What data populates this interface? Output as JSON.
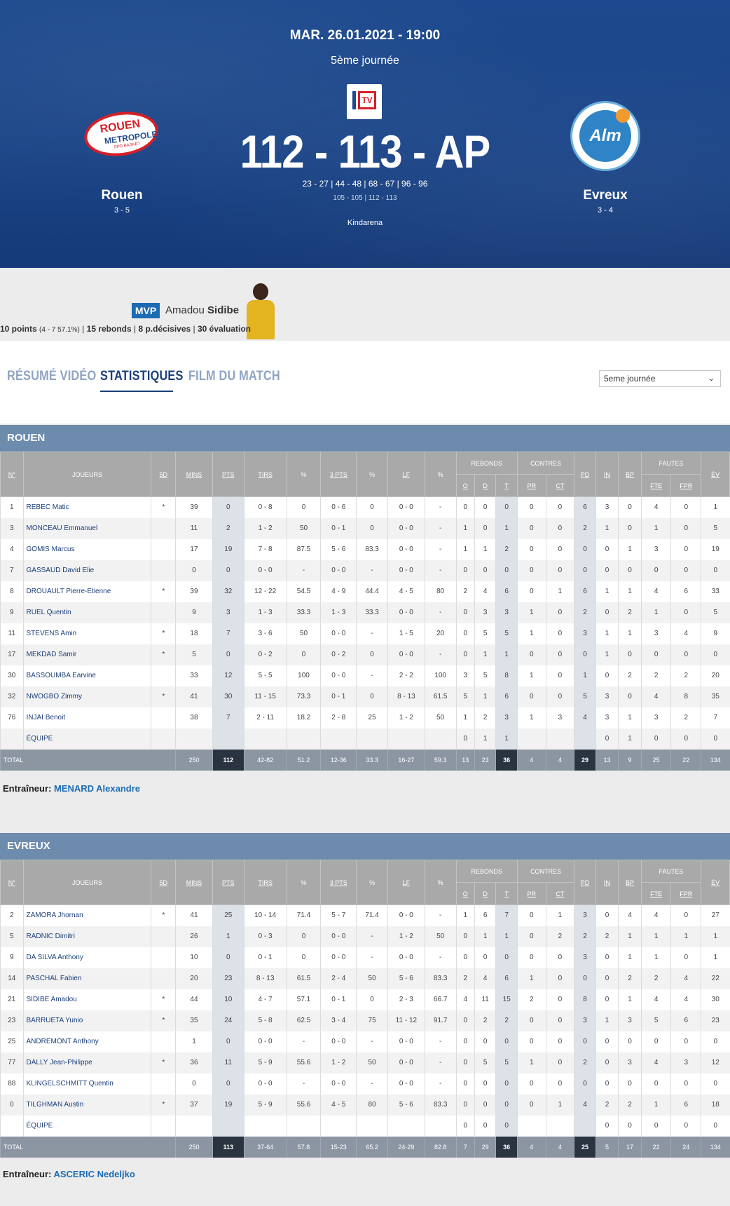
{
  "match": {
    "date": "MAR. 26.01.2021 - 19:00",
    "round": "5ème journée",
    "tv_label": "TV",
    "score": "112 - 113 - AP",
    "quarters": "23 - 27 | 44 - 48 | 68 - 67 | 96 - 96",
    "overtime": "105 - 105 | 112 - 113",
    "venue": "Kindarena",
    "home": {
      "name": "Rouen",
      "record": "3 - 5",
      "logo_line1": "ROUEN",
      "logo_line2": "METROPOLE",
      "logo_line3": "SPO BASKET"
    },
    "away": {
      "name": "Evreux",
      "record": "3 - 4",
      "logo_text": "Alm"
    }
  },
  "mvp": {
    "badge": "MVP",
    "first_name": "Amadou",
    "last_name": "Sidibe",
    "points": "10 points",
    "shooting": "(4 - 7 57.1%)",
    "rebounds": "15 rebonds",
    "assists": "8 p.décisives",
    "evaluation": "30 évaluation"
  },
  "tabs": [
    "RÉSUMÉ VIDÉO",
    "STATISTIQUES",
    "FILM DU MATCH"
  ],
  "round_select": {
    "value": "5eme journée"
  },
  "headers": {
    "num": "N°",
    "player": "JOUEURS",
    "five": "5D",
    "mins": "MINS",
    "pts": "PTS",
    "tirs": "TIRS",
    "pct": "%",
    "three": "3 PTS",
    "lf": "LF",
    "rebonds": "REBONDS",
    "o": "O",
    "d": "D",
    "t": "T",
    "contres": "CONTRES",
    "pr": "PR",
    "ct": "CT",
    "pd": "PD",
    "in": "IN",
    "bp": "BP",
    "fautes": "FAUTES",
    "fte": "FTE",
    "fpr": "FPR",
    "ev": "ÉV"
  },
  "teams": [
    {
      "name": "ROUEN",
      "coach_label": "Entraîneur:",
      "coach": "MENARD Alexandre",
      "rows": [
        [
          "1",
          "REBEC Matic",
          "*",
          "39",
          "0",
          "0 - 8",
          "0",
          "0 - 6",
          "0",
          "0 - 0",
          "-",
          "0",
          "0",
          "0",
          "0",
          "0",
          "6",
          "3",
          "0",
          "4",
          "0",
          "1"
        ],
        [
          "3",
          "MONCEAU Emmanuel",
          "",
          "11",
          "2",
          "1 - 2",
          "50",
          "0 - 1",
          "0",
          "0 - 0",
          "-",
          "1",
          "0",
          "1",
          "0",
          "0",
          "2",
          "1",
          "0",
          "1",
          "0",
          "5"
        ],
        [
          "4",
          "GOMIS Marcus",
          "",
          "17",
          "19",
          "7 - 8",
          "87.5",
          "5 - 6",
          "83.3",
          "0 - 0",
          "-",
          "1",
          "1",
          "2",
          "0",
          "0",
          "0",
          "0",
          "1",
          "3",
          "0",
          "19"
        ],
        [
          "7",
          "GASSAUD David Elie",
          "",
          "0",
          "0",
          "0 - 0",
          "-",
          "0 - 0",
          "-",
          "0 - 0",
          "-",
          "0",
          "0",
          "0",
          "0",
          "0",
          "0",
          "0",
          "0",
          "0",
          "0",
          "0"
        ],
        [
          "8",
          "DROUAULT Pierre-Etienne",
          "*",
          "39",
          "32",
          "12 - 22",
          "54.5",
          "4 - 9",
          "44.4",
          "4 - 5",
          "80",
          "2",
          "4",
          "6",
          "0",
          "1",
          "6",
          "1",
          "1",
          "4",
          "6",
          "33"
        ],
        [
          "9",
          "RUEL Quentin",
          "",
          "9",
          "3",
          "1 - 3",
          "33.3",
          "1 - 3",
          "33.3",
          "0 - 0",
          "-",
          "0",
          "3",
          "3",
          "1",
          "0",
          "2",
          "0",
          "2",
          "1",
          "0",
          "5"
        ],
        [
          "11",
          "STEVENS Amin",
          "*",
          "18",
          "7",
          "3 - 6",
          "50",
          "0 - 0",
          "-",
          "1 - 5",
          "20",
          "0",
          "5",
          "5",
          "1",
          "0",
          "3",
          "1",
          "1",
          "3",
          "4",
          "9"
        ],
        [
          "17",
          "MEKDAD Samir",
          "*",
          "5",
          "0",
          "0 - 2",
          "0",
          "0 - 2",
          "0",
          "0 - 0",
          "-",
          "0",
          "1",
          "1",
          "0",
          "0",
          "0",
          "1",
          "0",
          "0",
          "0",
          "0"
        ],
        [
          "30",
          "BASSOUMBA Earvine",
          "",
          "33",
          "12",
          "5 - 5",
          "100",
          "0 - 0",
          "-",
          "2 - 2",
          "100",
          "3",
          "5",
          "8",
          "1",
          "0",
          "1",
          "0",
          "2",
          "2",
          "2",
          "20"
        ],
        [
          "32",
          "NWOGBO Zimmy",
          "*",
          "41",
          "30",
          "11 - 15",
          "73.3",
          "0 - 1",
          "0",
          "8 - 13",
          "61.5",
          "5",
          "1",
          "6",
          "0",
          "0",
          "5",
          "3",
          "0",
          "4",
          "8",
          "35"
        ],
        [
          "76",
          "INJAI Benoit",
          "",
          "38",
          "7",
          "2 - 11",
          "18.2",
          "2 - 8",
          "25",
          "1 - 2",
          "50",
          "1",
          "2",
          "3",
          "1",
          "3",
          "4",
          "3",
          "1",
          "3",
          "2",
          "7"
        ],
        [
          "",
          "ÉQUIPE",
          "",
          "",
          "",
          "",
          "",
          "",
          "",
          "",
          "",
          "0",
          "1",
          "1",
          "",
          "",
          "",
          "0",
          "1",
          "0",
          "0",
          "0"
        ]
      ],
      "total": [
        "TOTAL",
        "250",
        "112",
        "42-82",
        "51.2",
        "12-36",
        "33.3",
        "16-27",
        "59.3",
        "13",
        "23",
        "36",
        "4",
        "4",
        "29",
        "13",
        "9",
        "25",
        "22",
        "134"
      ]
    },
    {
      "name": "EVREUX",
      "coach_label": "Entraîneur:",
      "coach": "ASCERIC Nedeljko",
      "rows": [
        [
          "2",
          "ZAMORA Jhornan",
          "*",
          "41",
          "25",
          "10 - 14",
          "71.4",
          "5 - 7",
          "71.4",
          "0 - 0",
          "-",
          "1",
          "6",
          "7",
          "0",
          "1",
          "3",
          "0",
          "4",
          "4",
          "0",
          "27"
        ],
        [
          "5",
          "RADNIC Dimitri",
          "",
          "26",
          "1",
          "0 - 3",
          "0",
          "0 - 0",
          "-",
          "1 - 2",
          "50",
          "0",
          "1",
          "1",
          "0",
          "2",
          "2",
          "2",
          "1",
          "1",
          "1",
          "1"
        ],
        [
          "9",
          "DA SILVA Anthony",
          "",
          "10",
          "0",
          "0 - 1",
          "0",
          "0 - 0",
          "-",
          "0 - 0",
          "-",
          "0",
          "0",
          "0",
          "0",
          "0",
          "3",
          "0",
          "1",
          "1",
          "0",
          "1"
        ],
        [
          "14",
          "PASCHAL Fabien",
          "",
          "20",
          "23",
          "8 - 13",
          "61.5",
          "2 - 4",
          "50",
          "5 - 6",
          "83.3",
          "2",
          "4",
          "6",
          "1",
          "0",
          "0",
          "0",
          "2",
          "2",
          "4",
          "22"
        ],
        [
          "21",
          "SIDIBE Amadou",
          "*",
          "44",
          "10",
          "4 - 7",
          "57.1",
          "0 - 1",
          "0",
          "2 - 3",
          "66.7",
          "4",
          "11",
          "15",
          "2",
          "0",
          "8",
          "0",
          "1",
          "4",
          "4",
          "30"
        ],
        [
          "23",
          "BARRUETA Yunio",
          "*",
          "35",
          "24",
          "5 - 8",
          "62.5",
          "3 - 4",
          "75",
          "11 - 12",
          "91.7",
          "0",
          "2",
          "2",
          "0",
          "0",
          "3",
          "1",
          "3",
          "5",
          "6",
          "23"
        ],
        [
          "25",
          "ANDREMONT Anthony",
          "",
          "1",
          "0",
          "0 - 0",
          "-",
          "0 - 0",
          "-",
          "0 - 0",
          "-",
          "0",
          "0",
          "0",
          "0",
          "0",
          "0",
          "0",
          "0",
          "0",
          "0",
          "0"
        ],
        [
          "77",
          "DALLY Jean-Philippe",
          "*",
          "36",
          "11",
          "5 - 9",
          "55.6",
          "1 - 2",
          "50",
          "0 - 0",
          "-",
          "0",
          "5",
          "5",
          "1",
          "0",
          "2",
          "0",
          "3",
          "4",
          "3",
          "12"
        ],
        [
          "88",
          "KLINGELSCHMITT Quentin",
          "",
          "0",
          "0",
          "0 - 0",
          "-",
          "0 - 0",
          "-",
          "0 - 0",
          "-",
          "0",
          "0",
          "0",
          "0",
          "0",
          "0",
          "0",
          "0",
          "0",
          "0",
          "0"
        ],
        [
          "0",
          "TILGHMAN Austin",
          "*",
          "37",
          "19",
          "5 - 9",
          "55.6",
          "4 - 5",
          "80",
          "5 - 6",
          "83.3",
          "0",
          "0",
          "0",
          "0",
          "1",
          "4",
          "2",
          "2",
          "1",
          "6",
          "18"
        ],
        [
          "",
          "ÉQUIPE",
          "",
          "",
          "",
          "",
          "",
          "",
          "",
          "",
          "",
          "0",
          "0",
          "0",
          "",
          "",
          "",
          "0",
          "0",
          "0",
          "0",
          "0"
        ]
      ],
      "total": [
        "TOTAL",
        "250",
        "113",
        "37-64",
        "57.8",
        "15-23",
        "65.2",
        "24-29",
        "82.8",
        "7",
        "29",
        "36",
        "4",
        "4",
        "25",
        "5",
        "17",
        "22",
        "24",
        "134"
      ]
    }
  ],
  "colors": {
    "hero": "#1d4a8e",
    "team_bar": "#6d8bad",
    "header_gray": "#a9a9a9",
    "link_blue": "#1c6bb3",
    "total_dark": "#2a3441"
  }
}
